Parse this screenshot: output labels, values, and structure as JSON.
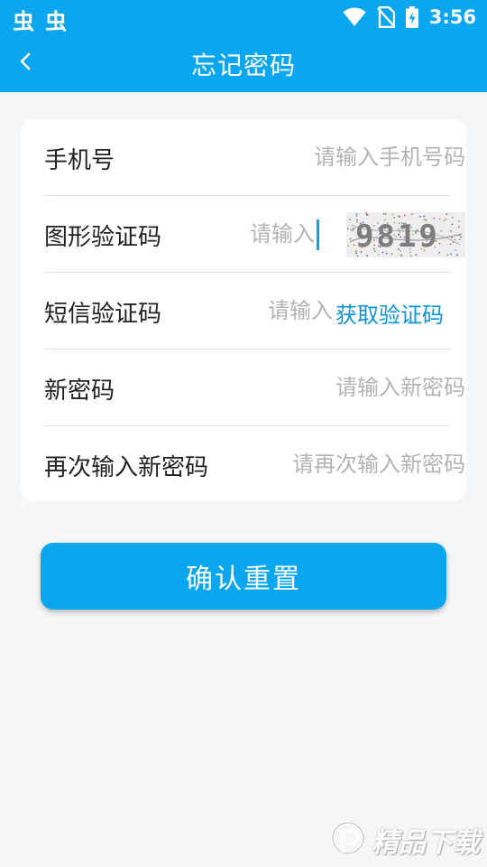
{
  "status_bar": {
    "app_icons": [
      "虫",
      "虫"
    ],
    "time": "3:56",
    "icons": [
      "wifi-icon",
      "no-sim-icon",
      "battery-charging-icon"
    ]
  },
  "header": {
    "title": "忘记密码",
    "back_icon": "chevron-left-icon",
    "background": "#0aa6f0"
  },
  "form": {
    "phone": {
      "label": "手机号",
      "placeholder": "请输入手机号码"
    },
    "image_code": {
      "label": "图形验证码",
      "placeholder": "请输入",
      "captcha_text": "9819"
    },
    "sms_code": {
      "label": "短信验证码",
      "placeholder": "请输入",
      "get_code_label": "获取验证码"
    },
    "new_password": {
      "label": "新密码",
      "placeholder": "请输入新密码"
    },
    "confirm_password": {
      "label": "再次输入新密码",
      "placeholder": "请再次输入新密码"
    }
  },
  "confirm_button": {
    "label": "确认重置"
  },
  "colors": {
    "accent": "#0aa6f0",
    "link": "#0a96d8",
    "page_background": "#f5f6f8"
  }
}
